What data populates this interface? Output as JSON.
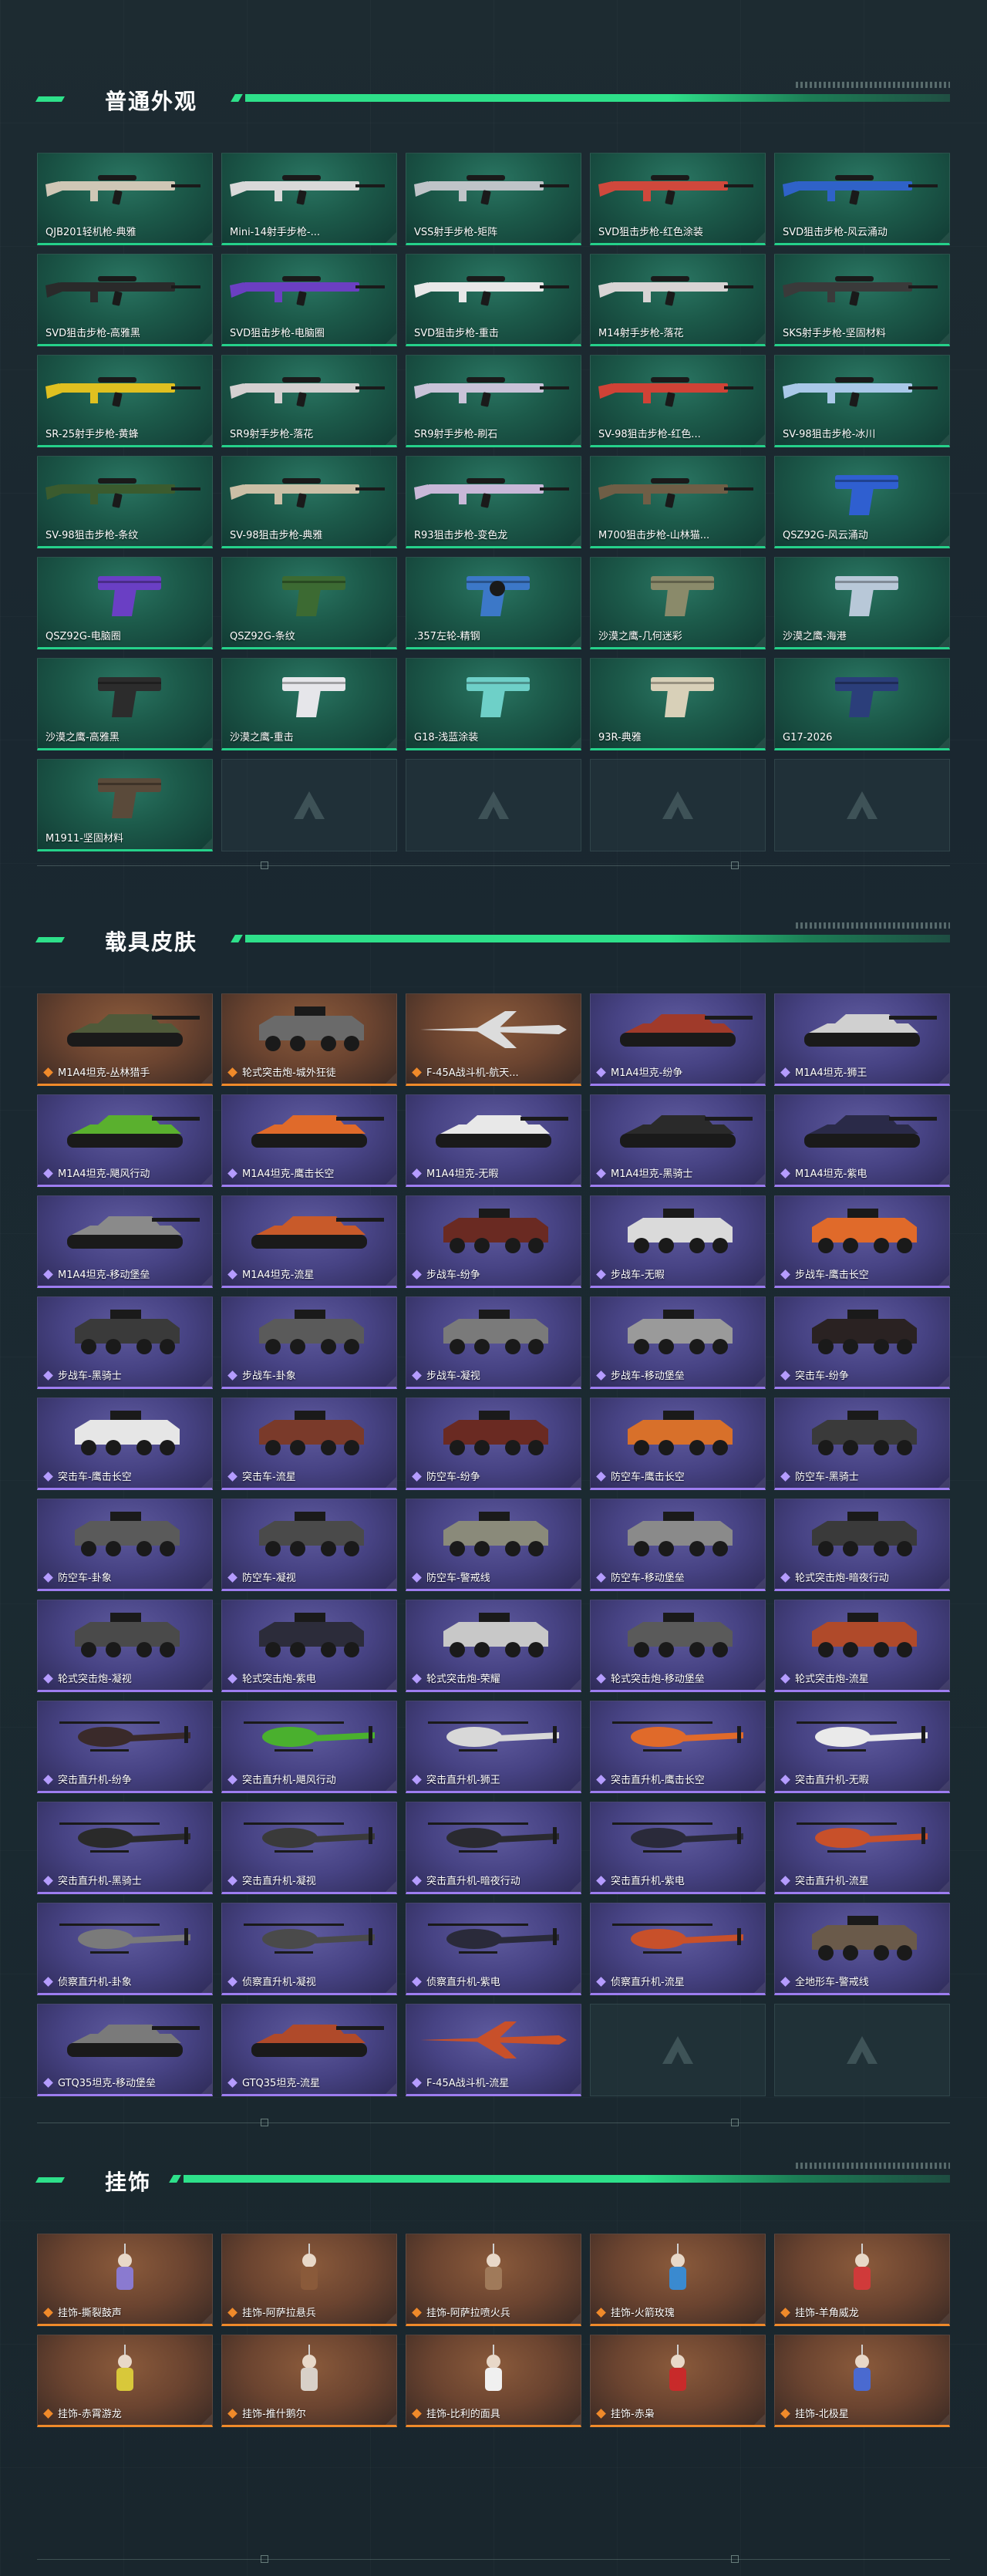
{
  "sections": [
    {
      "title": "普通外观",
      "style": "green",
      "items": [
        {
          "label": "QJB201轻机枪-典雅",
          "kind": "rifle",
          "color": "#cfc7b6"
        },
        {
          "label": "Mini-14射手步枪-...",
          "kind": "rifle",
          "color": "#d9d9d9"
        },
        {
          "label": "VSS射手步枪-矩阵",
          "kind": "rifle",
          "color": "#bfc4c8"
        },
        {
          "label": "SVD狙击步枪-红色涂装",
          "kind": "rifle",
          "color": "#d0483c"
        },
        {
          "label": "SVD狙击步枪-风云涌动",
          "kind": "rifle",
          "color": "#2f62c8"
        },
        {
          "label": "SVD狙击步枪-高雅黑",
          "kind": "rifle",
          "color": "#2a2a2a"
        },
        {
          "label": "SVD狙击步枪-电脑圈",
          "kind": "rifle",
          "color": "#6b3fc2"
        },
        {
          "label": "SVD狙击步枪-重击",
          "kind": "rifle",
          "color": "#e8e8e8"
        },
        {
          "label": "M14射手步枪-落花",
          "kind": "rifle",
          "color": "#d8d4d4"
        },
        {
          "label": "SKS射手步枪-坚固材料",
          "kind": "rifle",
          "color": "#3a3a3a"
        },
        {
          "label": "SR-25射手步枪-黄蜂",
          "kind": "rifle",
          "color": "#e0c020"
        },
        {
          "label": "SR9射手步枪-落花",
          "kind": "rifle",
          "color": "#d4d0d0"
        },
        {
          "label": "SR9射手步枪-刷石",
          "kind": "rifle",
          "color": "#c9c3d8"
        },
        {
          "label": "SV-98狙击步枪-红色...",
          "kind": "rifle",
          "color": "#d04236"
        },
        {
          "label": "SV-98狙击步枪-冰川",
          "kind": "rifle",
          "color": "#a9c8e8"
        },
        {
          "label": "SV-98狙击步枪-条纹",
          "kind": "rifle",
          "color": "#3b5b2e"
        },
        {
          "label": "SV-98狙击步枪-典雅",
          "kind": "rifle",
          "color": "#cbbfa6"
        },
        {
          "label": "R93狙击步枪-变色龙",
          "kind": "rifle",
          "color": "#c8b8d8"
        },
        {
          "label": "M700狙击步枪-山林猫...",
          "kind": "rifle",
          "color": "#6f5e46"
        },
        {
          "label": "QSZ92G-风云涌动",
          "kind": "pistol",
          "color": "#2f5fd0"
        },
        {
          "label": "QSZ92G-电脑圈",
          "kind": "pistol",
          "color": "#6a3fc4"
        },
        {
          "label": "QSZ92G-条纹",
          "kind": "pistol",
          "color": "#3c6a32"
        },
        {
          "label": ".357左轮-精钢",
          "kind": "revolver",
          "color": "#3c78c8"
        },
        {
          "label": "沙漠之鹰-几何迷彩",
          "kind": "pistol",
          "color": "#8a8a6a"
        },
        {
          "label": "沙漠之鹰-海港",
          "kind": "pistol",
          "color": "#b8c8d8"
        },
        {
          "label": "沙漠之鹰-高雅黑",
          "kind": "pistol",
          "color": "#2c2c2c"
        },
        {
          "label": "沙漠之鹰-重击",
          "kind": "pistol",
          "color": "#e6e6ea"
        },
        {
          "label": "G18-浅蓝涂装",
          "kind": "pistol",
          "color": "#6ed0c8"
        },
        {
          "label": "93R-典雅",
          "kind": "pistol",
          "color": "#d8d0b8"
        },
        {
          "label": "G17-2026",
          "kind": "pistol",
          "color": "#2b3e7a"
        },
        {
          "label": "M1911-坚固材料",
          "kind": "pistol",
          "color": "#5a4a3a"
        },
        {
          "label": "",
          "kind": "empty"
        },
        {
          "label": "",
          "kind": "empty"
        },
        {
          "label": "",
          "kind": "empty"
        },
        {
          "label": "",
          "kind": "empty"
        }
      ]
    },
    {
      "title": "载具皮肤",
      "style": "mixed",
      "items": [
        {
          "label": "M1A4坦克-丛林猎手",
          "kind": "tank",
          "tier": "orange",
          "color": "#4f5a3a"
        },
        {
          "label": "轮式突击炮-城外狂徒",
          "kind": "apc",
          "tier": "orange",
          "color": "#6a6a6a"
        },
        {
          "label": "F-45A战斗机-航天...",
          "kind": "jet",
          "tier": "orange",
          "color": "#dcdcdc"
        },
        {
          "label": "M1A4坦克-纷争",
          "kind": "tank",
          "tier": "purple",
          "color": "#a03a2a"
        },
        {
          "label": "M1A4坦克-狮王",
          "kind": "tank",
          "tier": "purple",
          "color": "#d0d0d0"
        },
        {
          "label": "M1A4坦克-飓风行动",
          "kind": "tank",
          "tier": "purple",
          "color": "#5ab02e"
        },
        {
          "label": "M1A4坦克-鹰击长空",
          "kind": "tank",
          "tier": "purple",
          "color": "#e06a2a"
        },
        {
          "label": "M1A4坦克-无暇",
          "kind": "tank",
          "tier": "purple",
          "color": "#e8e8e8"
        },
        {
          "label": "M1A4坦克-黑骑士",
          "kind": "tank",
          "tier": "purple",
          "color": "#2a2a2a"
        },
        {
          "label": "M1A4坦克-紫电",
          "kind": "tank",
          "tier": "purple",
          "color": "#2a2a48"
        },
        {
          "label": "M1A4坦克-移动堡垒",
          "kind": "tank",
          "tier": "purple",
          "color": "#8a8a8a"
        },
        {
          "label": "M1A4坦克-流星",
          "kind": "tank",
          "tier": "purple",
          "color": "#c85a2a"
        },
        {
          "label": "步战车-纷争",
          "kind": "apc",
          "tier": "purple",
          "color": "#6a2a22"
        },
        {
          "label": "步战车-无暇",
          "kind": "apc",
          "tier": "purple",
          "color": "#dadada"
        },
        {
          "label": "步战车-鹰击长空",
          "kind": "apc",
          "tier": "purple",
          "color": "#e06a2a"
        },
        {
          "label": "步战车-黑骑士",
          "kind": "apc",
          "tier": "purple",
          "color": "#3a3a3a"
        },
        {
          "label": "步战车-卦象",
          "kind": "apc",
          "tier": "purple",
          "color": "#5a5a5a"
        },
        {
          "label": "步战车-凝视",
          "kind": "apc",
          "tier": "purple",
          "color": "#7a7a7a"
        },
        {
          "label": "步战车-移动堡垒",
          "kind": "apc",
          "tier": "purple",
          "color": "#9a9a9a"
        },
        {
          "label": "突击车-纷争",
          "kind": "suv",
          "tier": "purple",
          "color": "#2a2222"
        },
        {
          "label": "突击车-鹰击长空",
          "kind": "suv",
          "tier": "purple",
          "color": "#e6e6e6"
        },
        {
          "label": "突击车-流星",
          "kind": "suv",
          "tier": "purple",
          "color": "#7a3a2a"
        },
        {
          "label": "防空车-纷争",
          "kind": "apc",
          "tier": "purple",
          "color": "#6a2a22"
        },
        {
          "label": "防空车-鹰击长空",
          "kind": "apc",
          "tier": "purple",
          "color": "#d8702a"
        },
        {
          "label": "防空车-黑骑士",
          "kind": "apc",
          "tier": "purple",
          "color": "#3a3a3a"
        },
        {
          "label": "防空车-卦象",
          "kind": "apc",
          "tier": "purple",
          "color": "#5a5a5a"
        },
        {
          "label": "防空车-凝视",
          "kind": "apc",
          "tier": "purple",
          "color": "#4a4a4a"
        },
        {
          "label": "防空车-警戒线",
          "kind": "apc",
          "tier": "purple",
          "color": "#8a8a7a"
        },
        {
          "label": "防空车-移动堡垒",
          "kind": "apc",
          "tier": "purple",
          "color": "#8a8a8a"
        },
        {
          "label": "轮式突击炮-暗夜行动",
          "kind": "apc",
          "tier": "purple",
          "color": "#3a3a3a"
        },
        {
          "label": "轮式突击炮-凝视",
          "kind": "apc",
          "tier": "purple",
          "color": "#4a4a4a"
        },
        {
          "label": "轮式突击炮-紫电",
          "kind": "apc",
          "tier": "purple",
          "color": "#2c2c3a"
        },
        {
          "label": "轮式突击炮-荣耀",
          "kind": "apc",
          "tier": "purple",
          "color": "#c8c8c8"
        },
        {
          "label": "轮式突击炮-移动堡垒",
          "kind": "apc",
          "tier": "purple",
          "color": "#5a5a5a"
        },
        {
          "label": "轮式突击炮-流星",
          "kind": "apc",
          "tier": "purple",
          "color": "#b04a2a"
        },
        {
          "label": "突击直升机-纷争",
          "kind": "heli",
          "tier": "purple",
          "color": "#3a2a2a"
        },
        {
          "label": "突击直升机-飓风行动",
          "kind": "heli",
          "tier": "purple",
          "color": "#4ab02e"
        },
        {
          "label": "突击直升机-狮王",
          "kind": "heli",
          "tier": "purple",
          "color": "#d8d8d8"
        },
        {
          "label": "突击直升机-鹰击长空",
          "kind": "heli",
          "tier": "purple",
          "color": "#e06a2a"
        },
        {
          "label": "突击直升机-无暇",
          "kind": "heli",
          "tier": "purple",
          "color": "#eaeaea"
        },
        {
          "label": "突击直升机-黑骑士",
          "kind": "heli",
          "tier": "purple",
          "color": "#2a2a2a"
        },
        {
          "label": "突击直升机-凝视",
          "kind": "heli",
          "tier": "purple",
          "color": "#3a3a3a"
        },
        {
          "label": "突击直升机-暗夜行动",
          "kind": "heli",
          "tier": "purple",
          "color": "#2a2a30"
        },
        {
          "label": "突击直升机-紫电",
          "kind": "heli",
          "tier": "purple",
          "color": "#2a2a3a"
        },
        {
          "label": "突击直升机-流星",
          "kind": "heli",
          "tier": "purple",
          "color": "#c8502a"
        },
        {
          "label": "侦察直升机-卦象",
          "kind": "heli",
          "tier": "purple",
          "color": "#7a7a7a"
        },
        {
          "label": "侦察直升机-凝视",
          "kind": "heli",
          "tier": "purple",
          "color": "#4a4a4a"
        },
        {
          "label": "侦察直升机-紫电",
          "kind": "heli",
          "tier": "purple",
          "color": "#2a2a3a"
        },
        {
          "label": "侦察直升机-流星",
          "kind": "heli",
          "tier": "purple",
          "color": "#c8502a"
        },
        {
          "label": "全地形车-警戒线",
          "kind": "atv",
          "tier": "purple",
          "color": "#6a5a4a"
        },
        {
          "label": "GTQ35坦克-移动堡垒",
          "kind": "tank",
          "tier": "purple",
          "color": "#7a7a7a"
        },
        {
          "label": "GTQ35坦克-流星",
          "kind": "tank",
          "tier": "purple",
          "color": "#b04a2a"
        },
        {
          "label": "F-45A战斗机-流星",
          "kind": "jet",
          "tier": "purple",
          "color": "#c8502a"
        },
        {
          "label": "",
          "kind": "empty"
        },
        {
          "label": "",
          "kind": "empty"
        }
      ]
    },
    {
      "title": "挂饰",
      "style": "orange",
      "items": [
        {
          "label": "挂饰-撕裂鼓声",
          "kind": "charm",
          "color": "#8a7ad0"
        },
        {
          "label": "挂饰-阿萨拉悬兵",
          "kind": "charm",
          "color": "#8a5a3a"
        },
        {
          "label": "挂饰-阿萨拉喷火兵",
          "kind": "charm",
          "color": "#a07a5a"
        },
        {
          "label": "挂饰-火箭玫瑰",
          "kind": "charm",
          "color": "#3a8ad0"
        },
        {
          "label": "挂饰-羊角威龙",
          "kind": "charm",
          "color": "#d03a3a"
        },
        {
          "label": "挂饰-赤霄游龙",
          "kind": "charm",
          "color": "#d8c83a"
        },
        {
          "label": "挂饰-推什鹅尔",
          "kind": "charm",
          "color": "#d8d0c8"
        },
        {
          "label": "挂饰-比利的面具",
          "kind": "charm",
          "color": "#f0f0f0"
        },
        {
          "label": "挂饰-赤枭",
          "kind": "charm",
          "color": "#c82a2a"
        },
        {
          "label": "挂饰-北极星",
          "kind": "charm",
          "color": "#4a6ad0"
        }
      ]
    }
  ]
}
